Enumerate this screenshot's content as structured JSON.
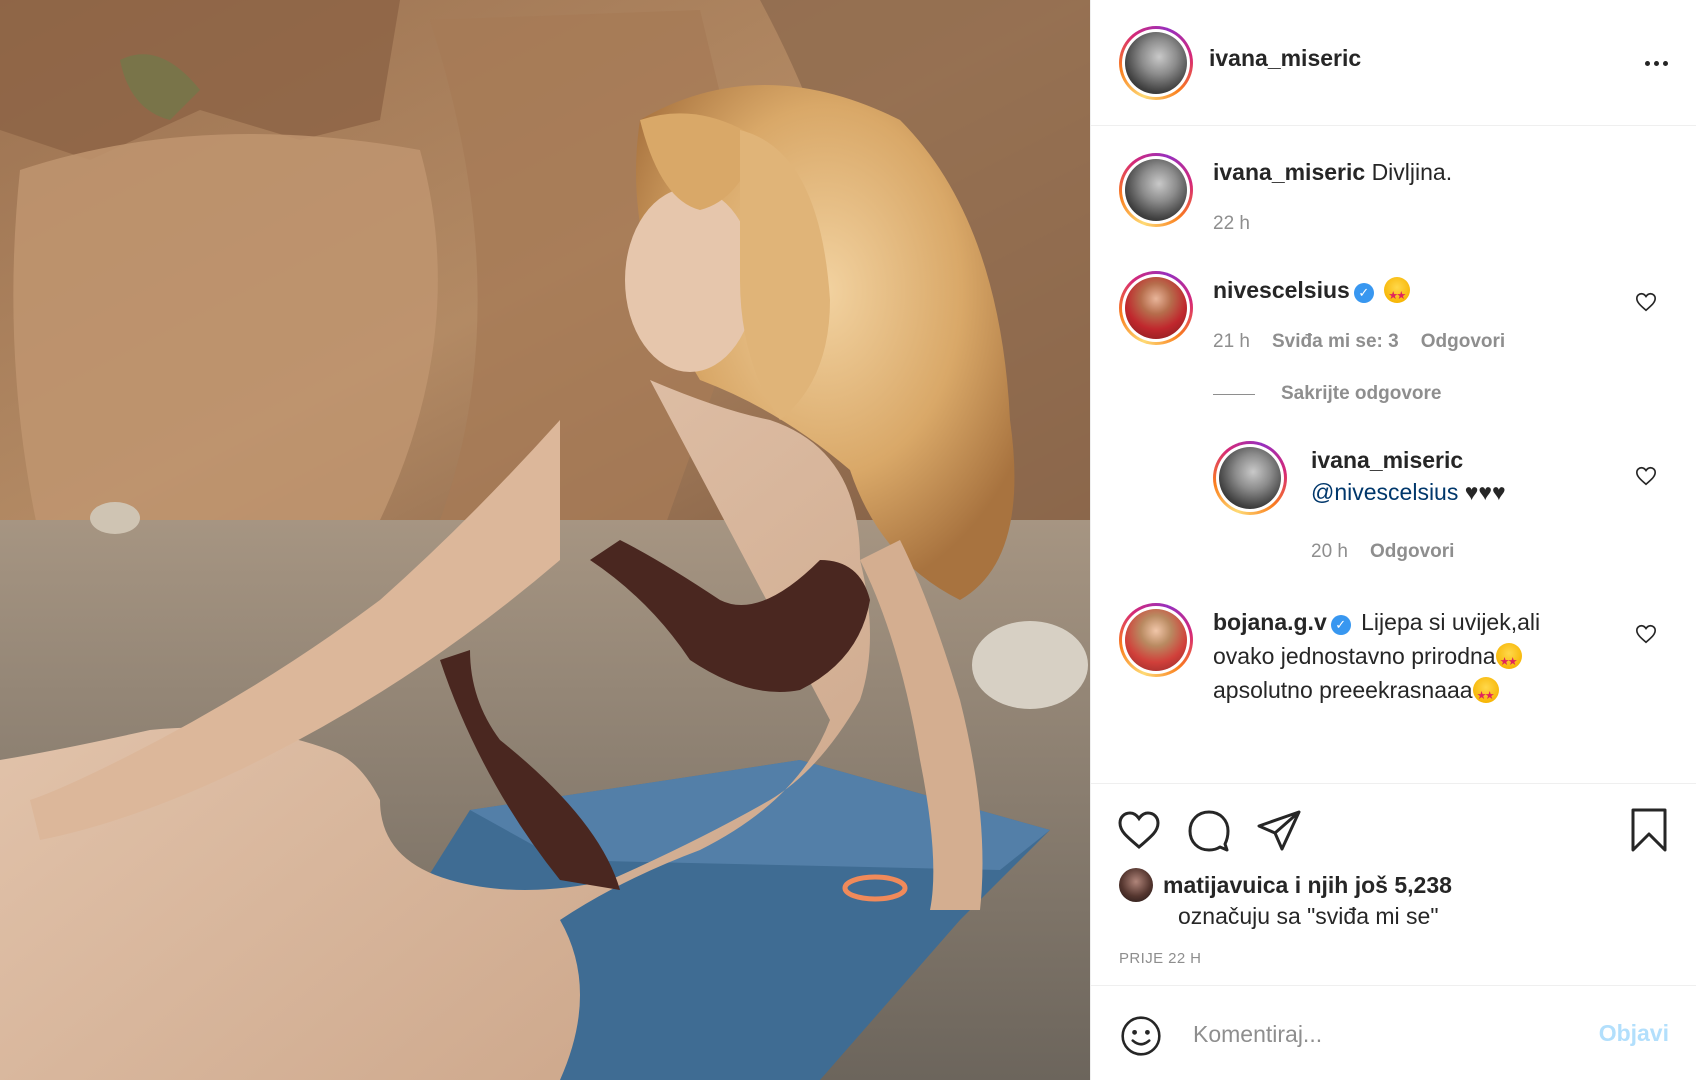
{
  "post": {
    "author": "ivana_miseric",
    "caption": {
      "username": "ivana_miseric",
      "text": "Divljina.",
      "time": "22 h"
    }
  },
  "comments": [
    {
      "username": "nivescelsius",
      "verified": true,
      "emoji": "star-struck",
      "time": "21 h",
      "likes": "Sviđa mi se: 3",
      "reply_label": "Odgovori"
    },
    {
      "username": "bojana.g.v",
      "verified": true,
      "text_line1": "Lijepa si uvijek,ali",
      "text_line2": "ovako jednostavno prirodna",
      "text_line3": "apsolutno preeekrasnaaa"
    }
  ],
  "hide_replies": "Sakrijte odgovore",
  "reply": {
    "username": "ivana_miseric",
    "mention": "@nivescelsius",
    "hearts": "♥♥♥",
    "time": "20 h",
    "reply_label": "Odgovori"
  },
  "likes": {
    "user": "matijavuica",
    "others": "i njih još 5,238",
    "suffix": "označuju sa \"sviđa mi se\""
  },
  "post_time": "PRIJE 22 H",
  "comment_form": {
    "placeholder": "Komentiraj...",
    "post_label": "Objavi"
  },
  "icons": {
    "more": "more-horizontal-icon",
    "like": "heart-icon",
    "comment": "comment-bubble-icon",
    "share": "paper-plane-icon",
    "save": "bookmark-icon",
    "emoji": "smiley-icon"
  },
  "colors": {
    "text": "#262626",
    "secondary": "#8e8e8e",
    "link": "#00376b",
    "verified": "#3897f0",
    "post_disabled": "#b2dffc",
    "divider": "#efefef"
  }
}
